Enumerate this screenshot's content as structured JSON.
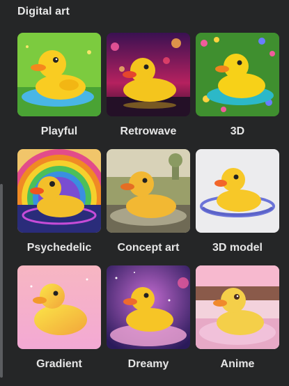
{
  "section": {
    "title": "Digital art"
  },
  "styles": [
    {
      "label": "Playful",
      "icon": "duck-playful-thumbnail"
    },
    {
      "label": "Retrowave",
      "icon": "duck-retrowave-thumbnail"
    },
    {
      "label": "3D",
      "icon": "duck-3d-thumbnail"
    },
    {
      "label": "Psychedelic",
      "icon": "duck-psychedelic-thumbnail"
    },
    {
      "label": "Concept art",
      "icon": "duck-concept-art-thumbnail"
    },
    {
      "label": "3D model",
      "icon": "duck-3d-model-thumbnail"
    },
    {
      "label": "Gradient",
      "icon": "duck-gradient-thumbnail"
    },
    {
      "label": "Dreamy",
      "icon": "duck-dreamy-thumbnail"
    },
    {
      "label": "Anime",
      "icon": "duck-anime-thumbnail"
    }
  ],
  "colors": {
    "background": "#252627",
    "text": "#e6e6e6",
    "duck": "#f7c81e",
    "beak": "#f08a1c"
  }
}
